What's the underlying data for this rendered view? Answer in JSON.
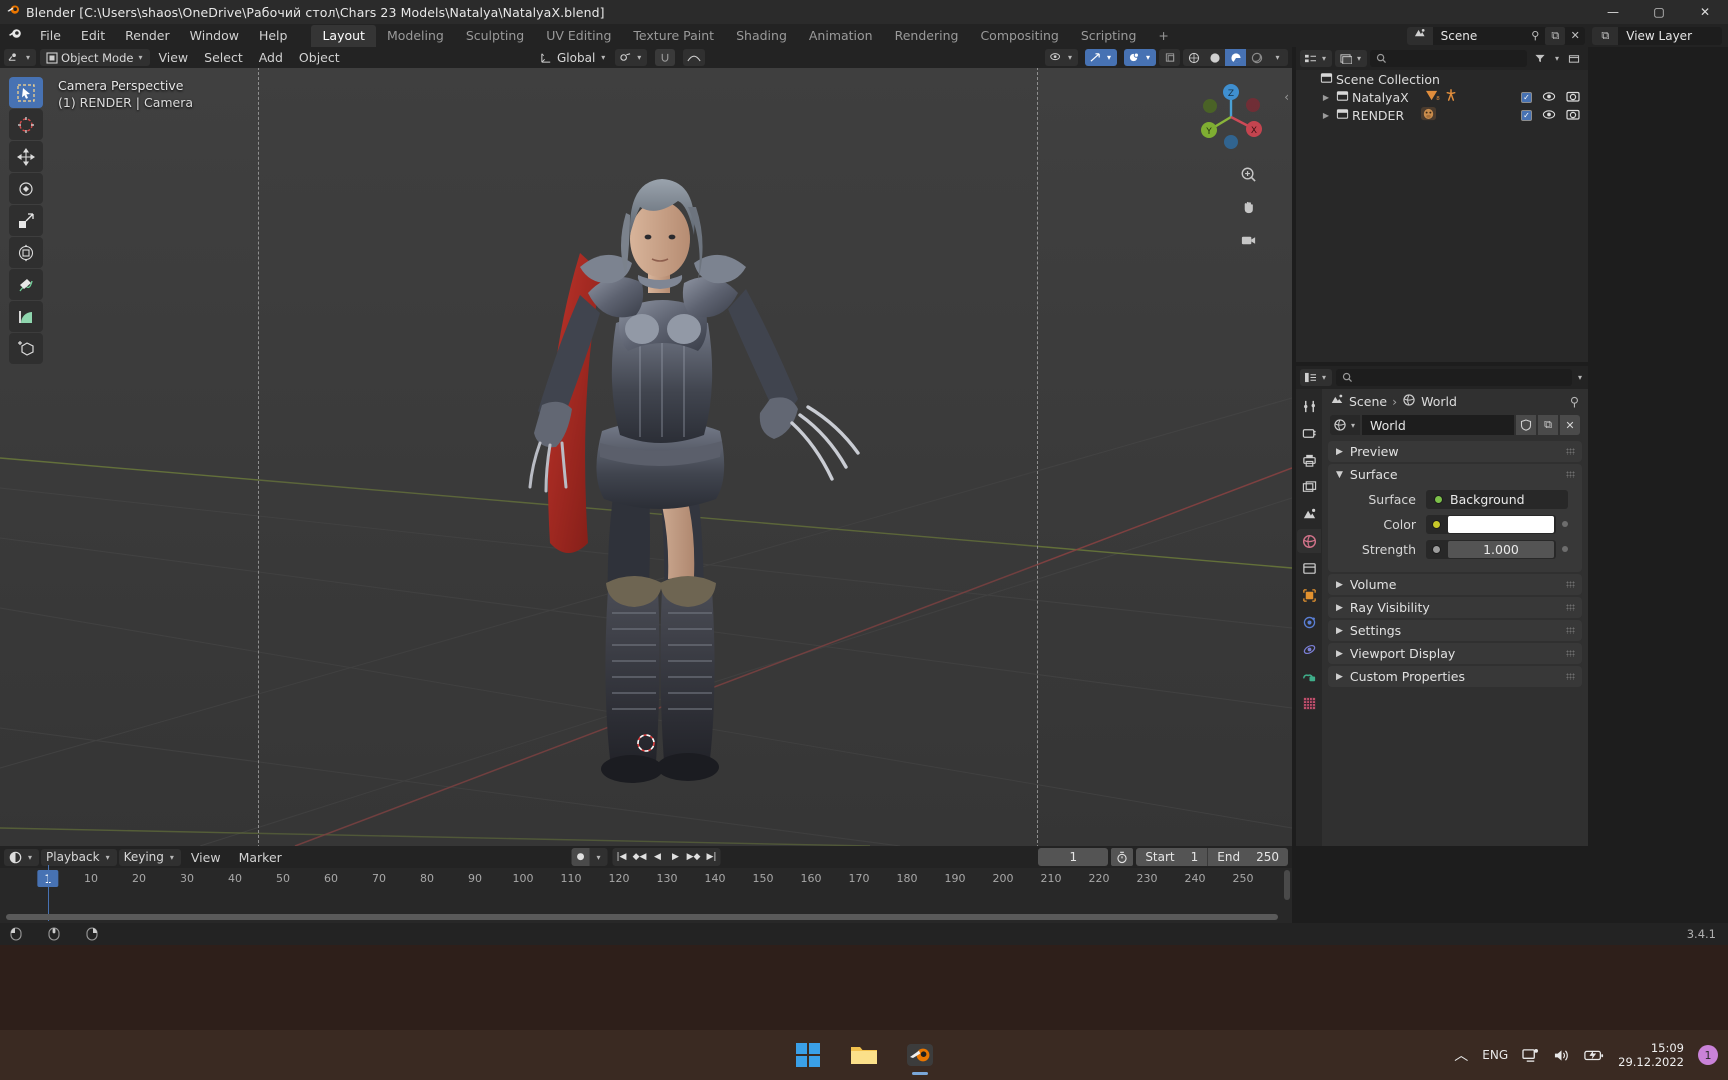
{
  "window": {
    "title": "Blender [C:\\Users\\shaos\\OneDrive\\Рабочий стол\\Chars 23 Models\\Natalya\\NatalyaX.blend]",
    "minimize": "—",
    "maximize": "▢",
    "close": "✕"
  },
  "topbar": {
    "menus": [
      "File",
      "Edit",
      "Render",
      "Window",
      "Help"
    ],
    "workspaces": [
      {
        "label": "Layout",
        "active": true
      },
      {
        "label": "Modeling",
        "active": false
      },
      {
        "label": "Sculpting",
        "active": false
      },
      {
        "label": "UV Editing",
        "active": false
      },
      {
        "label": "Texture Paint",
        "active": false
      },
      {
        "label": "Shading",
        "active": false
      },
      {
        "label": "Animation",
        "active": false
      },
      {
        "label": "Rendering",
        "active": false
      },
      {
        "label": "Compositing",
        "active": false
      },
      {
        "label": "Scripting",
        "active": false
      },
      {
        "label": "+",
        "active": false
      }
    ],
    "scene_name": "Scene",
    "view_layer_name": "View Layer"
  },
  "viewport_header": {
    "mode": "Object Mode",
    "menus": [
      "View",
      "Select",
      "Add",
      "Object"
    ],
    "transform_orientation": "Global",
    "shading_modes": [
      "wireframe",
      "solid",
      "material-preview",
      "rendered"
    ],
    "active_shading": "material-preview"
  },
  "viewport": {
    "overlay_line1": "Camera Perspective",
    "overlay_line2": "(1) RENDER | Camera",
    "gizmo_axes": [
      "X",
      "Y",
      "Z"
    ],
    "tools": [
      "tweak-select-tool",
      "cursor-tool",
      "move-tool",
      "rotate-tool",
      "scale-tool",
      "transform-tool",
      "annotate-tool",
      "measure-tool",
      "add-cube-tool"
    ],
    "side_buttons": [
      "zoom-icon",
      "hand-icon",
      "camera-view-icon"
    ]
  },
  "outliner": {
    "title": "Scene Collection",
    "rows": [
      {
        "label": "NatalyaX",
        "indent": 1,
        "icons": [
          "mesh-data-icon",
          "armature-icon"
        ],
        "checked": true
      },
      {
        "label": "RENDER",
        "indent": 1,
        "icons": [
          "monkey-icon"
        ],
        "checked": true
      }
    ],
    "search_placeholder": ""
  },
  "properties": {
    "breadcrumb": [
      "Scene",
      "World"
    ],
    "datablock_name": "World",
    "search_placeholder": "",
    "tabs": [
      "tool-icon",
      "render-icon",
      "output-icon",
      "view-layer-icon",
      "scene-icon",
      "world-icon",
      "collection-icon",
      "object-icon",
      "modifier-icon",
      "physics-icon",
      "constraints-icon",
      "material-icon"
    ],
    "active_tab": "world-icon",
    "panels": [
      {
        "label": "Preview",
        "open": false
      },
      {
        "label": "Surface",
        "open": true
      },
      {
        "label": "Volume",
        "open": false
      },
      {
        "label": "Ray Visibility",
        "open": false
      },
      {
        "label": "Settings",
        "open": false
      },
      {
        "label": "Viewport Display",
        "open": false
      },
      {
        "label": "Custom Properties",
        "open": false
      }
    ],
    "surface": {
      "surface_label": "Surface",
      "surface_value": "Background",
      "surface_socket_color": "#7dc14a",
      "color_label": "Color",
      "color_value": "#ffffff",
      "color_socket_color": "#c7c729",
      "strength_label": "Strength",
      "strength_value": "1.000",
      "strength_socket_color": "#9c9c9c"
    }
  },
  "timeline": {
    "menus": [
      "View",
      "Marker"
    ],
    "playback_label": "Playback",
    "keying_label": "Keying",
    "current_frame": "1",
    "start_label": "Start",
    "start_value": "1",
    "end_label": "End",
    "end_value": "250",
    "ticks": [
      "10",
      "20",
      "30",
      "40",
      "50",
      "60",
      "70",
      "80",
      "90",
      "100",
      "110",
      "120",
      "130",
      "140",
      "150",
      "160",
      "170",
      "180",
      "190",
      "200",
      "210",
      "220",
      "230",
      "240",
      "250"
    ],
    "playhead_frame": "1",
    "playback_buttons": [
      "jump-start-icon",
      "prev-keyframe-icon",
      "play-reverse-icon",
      "play-icon",
      "next-keyframe-icon",
      "jump-end-icon"
    ]
  },
  "statusbar": {
    "items": [
      {
        "icon": "mouse-select-icon",
        "label": ""
      },
      {
        "icon": "mouse-pan-icon",
        "label": ""
      },
      {
        "icon": "mouse-menu-icon",
        "label": ""
      }
    ],
    "version": "3.4.1"
  },
  "taskbar": {
    "apps": [
      "windows-start-icon",
      "file-explorer-icon",
      "blender-icon"
    ],
    "tray": {
      "chevron": "chevron-up-icon",
      "language": "ENG",
      "network": "network-icon",
      "volume": "volume-icon",
      "battery": "battery-icon",
      "time": "15:09",
      "date": "29.12.2022",
      "notification_count": "1"
    }
  },
  "colors": {
    "accent": "#4772b3",
    "panel_bg": "#303030",
    "editor_bg": "#282828",
    "header_bg": "#232323",
    "viewport_bg": "#3b3b3b"
  }
}
